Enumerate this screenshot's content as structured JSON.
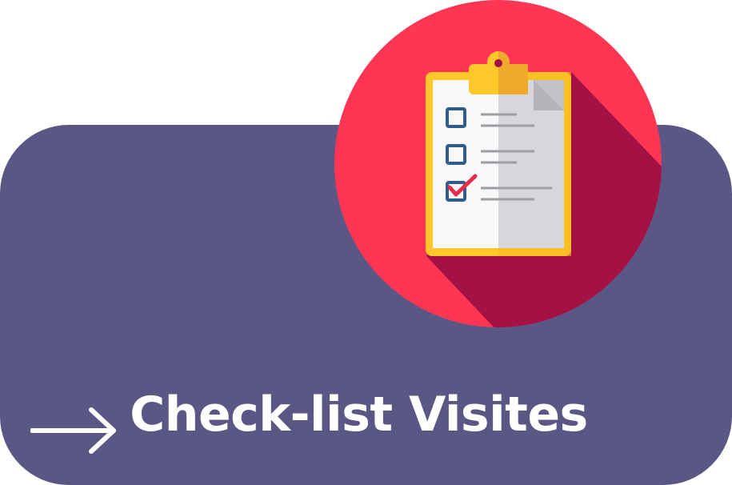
{
  "card": {
    "title": "Check-list Visites"
  },
  "icons": {
    "arrow": "arrow-right-icon",
    "badge": "clipboard-checklist-icon"
  },
  "checklist": [
    {
      "checked": false
    },
    {
      "checked": false
    },
    {
      "checked": true
    }
  ],
  "colors": {
    "card_background": "#5a5784",
    "circle": "#fe3553",
    "shadow": "#a31145",
    "clipboard": "#fec72a",
    "paper": "#f8f8f8",
    "checkbox": "#2e5d8c",
    "checkmark": "#e52c4a",
    "text": "#ffffff"
  }
}
